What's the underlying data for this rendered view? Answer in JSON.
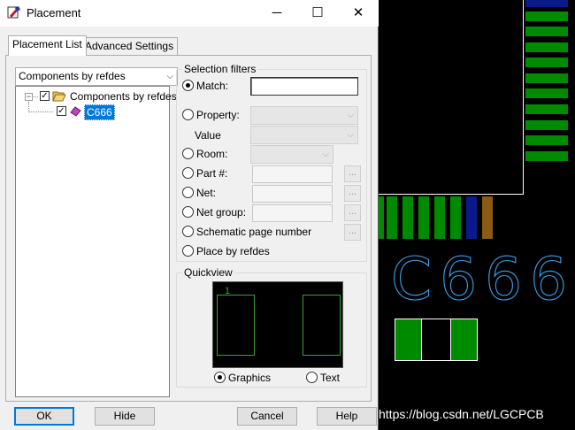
{
  "window": {
    "title": "Placement",
    "min": "─",
    "max": "☐",
    "close": "✕"
  },
  "tabs": [
    {
      "label": "Placement List"
    },
    {
      "label": "Advanced Settings"
    }
  ],
  "list": {
    "mode": "Components by refdes",
    "tree": {
      "root": "Components by refdes",
      "child": "C666"
    }
  },
  "filters": {
    "title": "Selection filters",
    "match": {
      "label": "Match:",
      "value": ""
    },
    "property": {
      "label": "Property:"
    },
    "value": {
      "label": "Value"
    },
    "room": {
      "label": "Room:"
    },
    "part": {
      "label": "Part #:",
      "dots": "..."
    },
    "net": {
      "label": "Net:",
      "dots": "..."
    },
    "netgroup": {
      "label": "Net group:",
      "dots": "..."
    },
    "schematic": {
      "label": "Schematic page number",
      "dots": "..."
    },
    "placeby": {
      "label": "Place by refdes"
    }
  },
  "quickview": {
    "title": "Quickview",
    "pin_label": "1",
    "graphics": "Graphics",
    "text": "Text"
  },
  "buttons": {
    "ok": "OK",
    "hide": "Hide",
    "cancel": "Cancel",
    "help": "Help"
  },
  "canvas": {
    "refdes": "C666",
    "watermark": "https://blog.csdn.net/LGCPCB"
  },
  "colors": {
    "pad_green": "#008a00",
    "silk_blue": "#3aa0e8",
    "pad_navy": "#0a1a8c",
    "pad_brown": "#8b5a14",
    "selection_blue": "#0078d7"
  }
}
